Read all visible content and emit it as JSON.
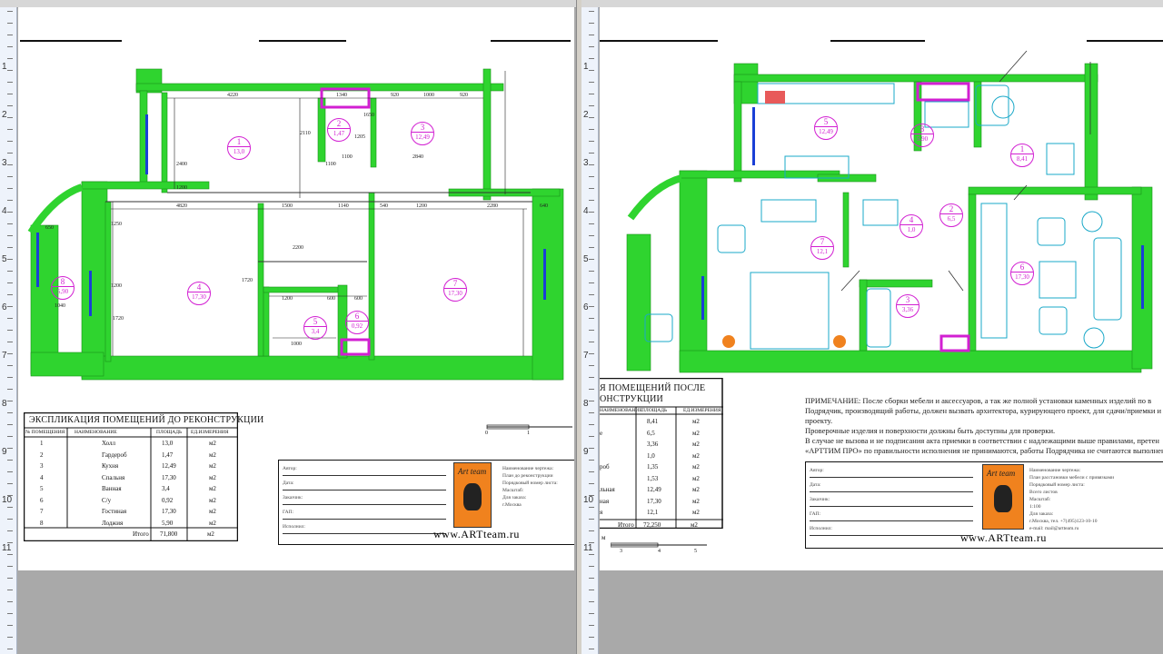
{
  "left_page": {
    "dims_top": [
      "4220",
      "1340",
      "920",
      "1000",
      "920"
    ],
    "dims_mid": [
      "4820",
      "1500",
      "1140",
      "540",
      "1200",
      "2280",
      "640"
    ],
    "dims_vert": [
      "2400",
      "1250",
      "1650",
      "2110",
      "1720",
      "2200",
      "1720",
      "1200",
      "1200"
    ],
    "dims_misc": [
      "1100",
      "1100",
      "1205",
      "2840",
      "650",
      "1040",
      "600",
      "600",
      "1200",
      "1000"
    ],
    "rooms": [
      {
        "num": "1",
        "area": "13,0"
      },
      {
        "num": "2",
        "area": "1,47"
      },
      {
        "num": "3",
        "area": "12,49"
      },
      {
        "num": "4",
        "area": "17,30"
      },
      {
        "num": "5",
        "area": "3,4"
      },
      {
        "num": "6",
        "area": "0,92"
      },
      {
        "num": "7",
        "area": "17,30"
      },
      {
        "num": "8",
        "area": "5,90"
      }
    ],
    "table": {
      "caption": "ЭКСПЛИКАЦИЯ ПОМЕЩЕНИЙ ДО РЕКОНСТРУКЦИИ",
      "headers": [
        "№ ПОМЕЩЕНИЯ",
        "НАИМЕНОВАНИЕ",
        "ПЛОЩАДЬ",
        "ЕД.ИЗМЕРЕНИЯ"
      ],
      "rows": [
        [
          "1",
          "Холл",
          "13,0",
          "м2"
        ],
        [
          "2",
          "Гардероб",
          "1,47",
          "м2"
        ],
        [
          "3",
          "Кухня",
          "12,49",
          "м2"
        ],
        [
          "4",
          "Спальня",
          "17,30",
          "м2"
        ],
        [
          "5",
          "Ванная",
          "3,4",
          "м2"
        ],
        [
          "6",
          "С/у",
          "0,92",
          "м2"
        ],
        [
          "7",
          "Гостиная",
          "17,30",
          "м2"
        ],
        [
          "8",
          "Лоджия",
          "5,90",
          "м2"
        ]
      ],
      "total_label": "Итого",
      "total_value": "71,800",
      "total_unit": "м2"
    },
    "scale_labels": [
      "0",
      "1"
    ],
    "stamp": {
      "fields": [
        "Автор:",
        "Дата:",
        "Заказчик:",
        "ГАП:",
        "Исполнил:"
      ],
      "right_labels": [
        "Наименование чертежа:",
        "План до реконструкции",
        "Порядковый номер листа:",
        "Масштаб:",
        "Для заказа:",
        "г.Москва"
      ],
      "logo_text": "Art team",
      "site": "www.ARTteam.ru"
    }
  },
  "right_page": {
    "rooms": [
      {
        "num": "1",
        "area": "8,41"
      },
      {
        "num": "2",
        "area": "6,5"
      },
      {
        "num": "3",
        "area": "3,36"
      },
      {
        "num": "4",
        "area": "1,0"
      },
      {
        "num": "5",
        "area": "12,49"
      },
      {
        "num": "6",
        "area": "17,30"
      },
      {
        "num": "7",
        "area": "12,1"
      },
      {
        "num": "8",
        "area": "5,90"
      }
    ],
    "table": {
      "caption_line1": "Я ПОМЕЩЕНИЙ ПОСЛЕ",
      "caption_line2": "ОНСТРУКЦИИ",
      "headers": [
        "НАИМЕНОВАНИЕ",
        "ПЛОЩАДЬ",
        "ЕД.ИЗМЕРЕНИЯ"
      ],
      "rows": [
        [
          "",
          "8,41",
          "м2"
        ],
        [
          "е",
          "6,5",
          "м2"
        ],
        [
          "",
          "3,36",
          "м2"
        ],
        [
          "",
          "1,0",
          "м2"
        ],
        [
          "роб",
          "1,35",
          "м2"
        ],
        [
          "",
          "1,53",
          "м2"
        ],
        [
          "льная",
          "12,49",
          "м2"
        ],
        [
          "ная",
          "17,30",
          "м2"
        ],
        [
          "я",
          "12,1",
          "м2"
        ]
      ],
      "total_label": "Итого",
      "total_value": "72,250",
      "total_unit": "м2"
    },
    "note_lines": [
      "ПРИМЕЧАНИЕ: После сборки мебели и аксессуаров, а так же полной установки каменных изделий по в",
      "Подрядчик, производящий работы, должен вызвать архитектора, курирующего проект, для сдачи/приемки и",
      "проекту.",
      "Проверочные изделия и поверхности должны быть доступны для проверки.",
      "В случае не вызова и не подписания акта приемки в соответствии с надлежащими выше правилами, претен",
      "«АРТТИМ ПРО» по правильности исполнения не принимаются, работы Подрядчика не считаются выполненными"
    ],
    "scale_labels": [
      "3",
      "4",
      "5"
    ],
    "scale_prefix": "м",
    "stamp": {
      "fields": [
        "Автор:",
        "Дата:",
        "Заказчик:",
        "ГАП:",
        "Исполнил:"
      ],
      "right_labels": [
        "Наименование чертежа:",
        "План расстановки мебели с привязками",
        "Порядковый номер листа:",
        "Всего листов",
        "Масштаб:",
        "1:100",
        "Для заказа:",
        "г.Москва, тел. +7(495)123-10-10",
        "e-mail: mail@artteam.ru"
      ],
      "logo_text": "Art team",
      "site": "www.ARTteam.ru"
    }
  },
  "ruler": {
    "left_numbers": [
      "1",
      "2",
      "3",
      "4",
      "5",
      "6",
      "7",
      "8",
      "9",
      "10",
      "11"
    ],
    "right_numbers": [
      "1",
      "2",
      "3",
      "4",
      "5",
      "6",
      "7",
      "8",
      "9",
      "10",
      "11"
    ]
  },
  "colors": {
    "wall": "#2fd42f",
    "room_label": "#d21fd2",
    "furniture": "#1aa8c8",
    "window": "#1a3fd6",
    "logo_bg": "#f0821e"
  }
}
